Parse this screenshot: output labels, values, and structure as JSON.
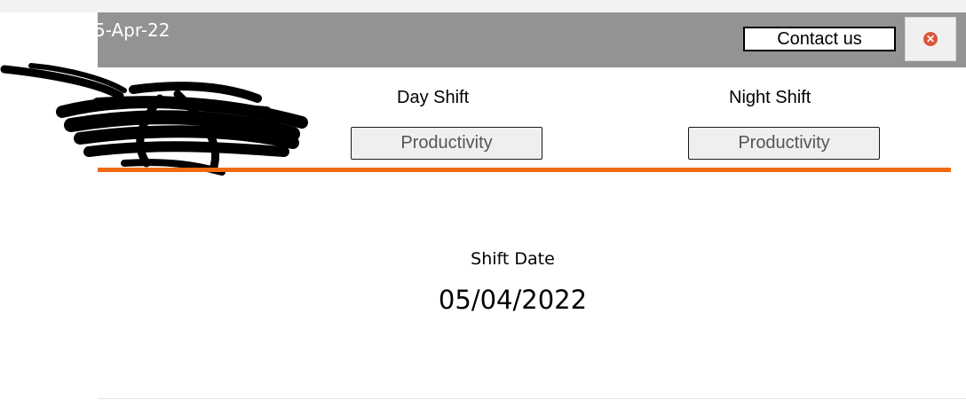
{
  "header": {
    "date": "5-Apr-22",
    "contact_label": "Contact us",
    "close_icon": "close-icon"
  },
  "shifts": {
    "day": {
      "label": "Day Shift",
      "button_label": "Productivity"
    },
    "night": {
      "label": "Night Shift",
      "button_label": "Productivity"
    }
  },
  "main": {
    "shift_date_label": "Shift Date",
    "shift_date_value": "05/04/2022"
  },
  "colors": {
    "header_bg": "#939393",
    "accent_rule": "#ee6a12",
    "close_icon": "#d9573b"
  }
}
